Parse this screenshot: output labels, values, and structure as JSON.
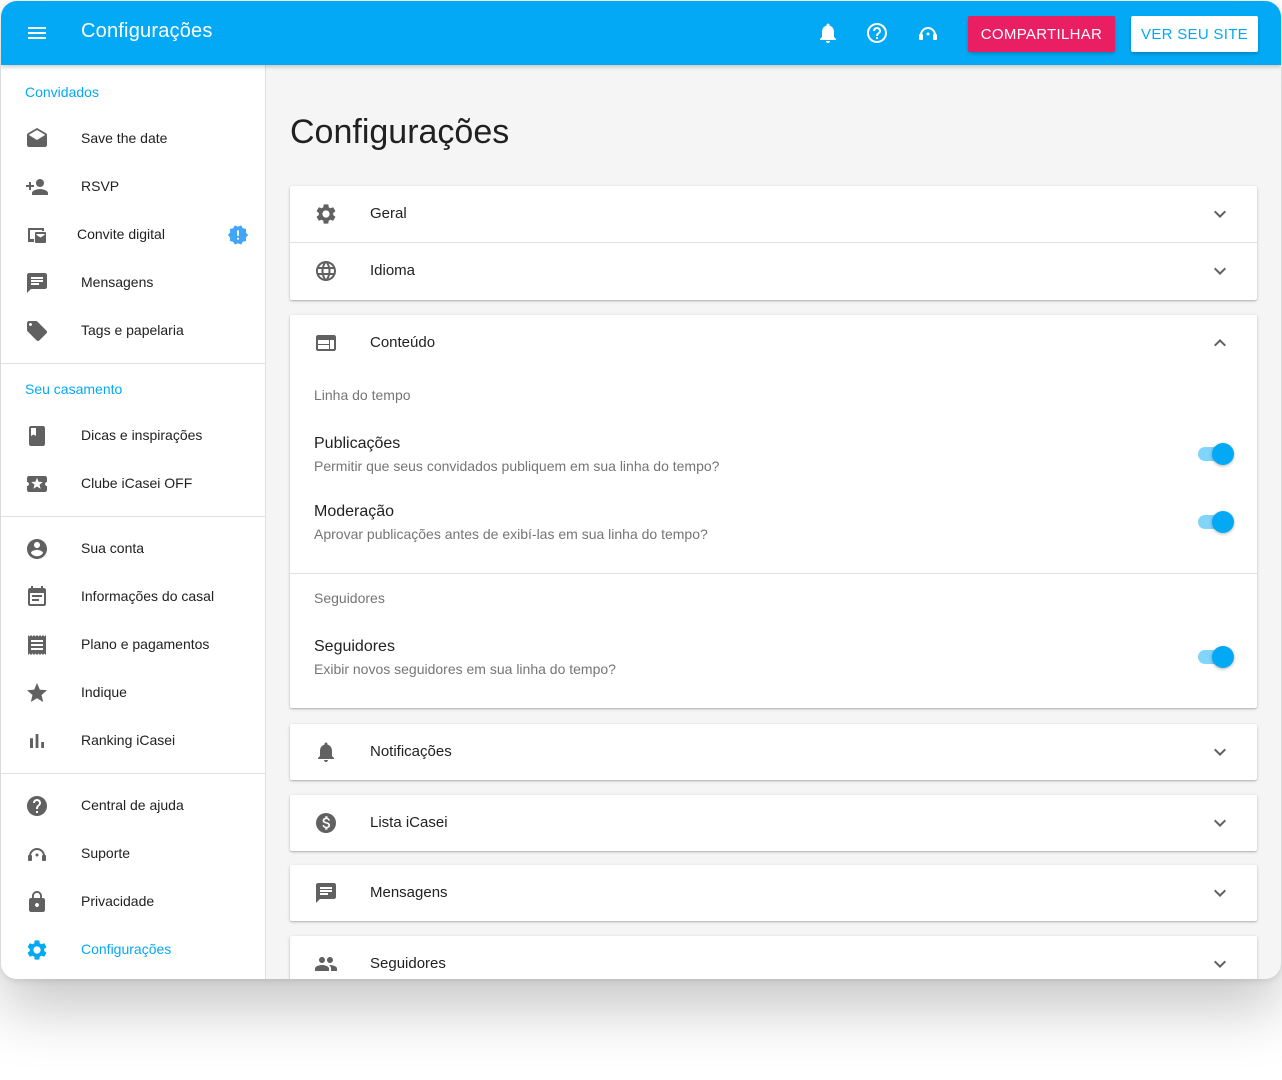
{
  "header": {
    "title": "Configurações",
    "share_label": "Compartilhar",
    "site_label": "Ver seu site",
    "icons": [
      "menu-icon",
      "bell-icon",
      "help-icon",
      "support-icon"
    ]
  },
  "colors": {
    "primary": "#03a9f4",
    "accent": "#e91e63",
    "text": "#212121",
    "secondary_text": "#757575",
    "background": "#f5f5f5"
  },
  "sidebar": {
    "sections": [
      {
        "title": "Convidados",
        "items": [
          {
            "label": "Save the date",
            "icon": "envelope-open-icon"
          },
          {
            "label": "RSVP",
            "icon": "person-add-icon"
          },
          {
            "label": "Convite digital",
            "icon": "digital-invite-icon",
            "badge": "alert-badge-icon"
          },
          {
            "label": "Mensagens",
            "icon": "message-icon"
          },
          {
            "label": "Tags e papelaria",
            "icon": "tag-icon"
          }
        ]
      },
      {
        "title": "Seu casamento",
        "items": [
          {
            "label": "Dicas e inspirações",
            "icon": "book-icon"
          },
          {
            "label": "Clube iCasei OFF",
            "icon": "ticket-star-icon"
          }
        ]
      },
      {
        "title": "",
        "items": [
          {
            "label": "Sua conta",
            "icon": "account-circle-icon"
          },
          {
            "label": "Informações do casal",
            "icon": "calendar-icon"
          },
          {
            "label": "Plano e pagamentos",
            "icon": "receipt-icon"
          },
          {
            "label": "Indique",
            "icon": "star-icon"
          },
          {
            "label": "Ranking iCasei",
            "icon": "bar-chart-icon"
          }
        ]
      },
      {
        "title": "",
        "items": [
          {
            "label": "Central de ajuda",
            "icon": "help-circle-icon"
          },
          {
            "label": "Suporte",
            "icon": "support-icon"
          },
          {
            "label": "Privacidade",
            "icon": "lock-icon"
          },
          {
            "label": "Configurações",
            "icon": "gear-icon",
            "active": true
          }
        ]
      }
    ]
  },
  "main": {
    "title": "Configurações",
    "panels": [
      {
        "label": "Geral",
        "icon": "gear-icon",
        "expanded": false
      },
      {
        "label": "Idioma",
        "icon": "globe-icon",
        "expanded": false
      },
      {
        "label": "Conteúdo",
        "icon": "web-layout-icon",
        "expanded": true,
        "groups": [
          {
            "heading": "Linha do tempo",
            "settings": [
              {
                "title": "Publicações",
                "description": "Permitir que seus convidados publiquem em sua linha do tempo?",
                "enabled": true
              },
              {
                "title": "Moderação",
                "description": "Aprovar publicações antes de exibí-las em sua linha do tempo?",
                "enabled": true
              }
            ]
          },
          {
            "heading": "Seguidores",
            "settings": [
              {
                "title": "Seguidores",
                "description": "Exibir novos seguidores em sua linha do tempo?",
                "enabled": true
              }
            ]
          }
        ]
      },
      {
        "label": "Notificações",
        "icon": "bell-icon",
        "expanded": false
      },
      {
        "label": "Lista iCasei",
        "icon": "dollar-circle-icon",
        "expanded": false
      },
      {
        "label": "Mensagens",
        "icon": "message-icon",
        "expanded": false
      },
      {
        "label": "Seguidores",
        "icon": "people-icon",
        "expanded": false
      }
    ]
  }
}
